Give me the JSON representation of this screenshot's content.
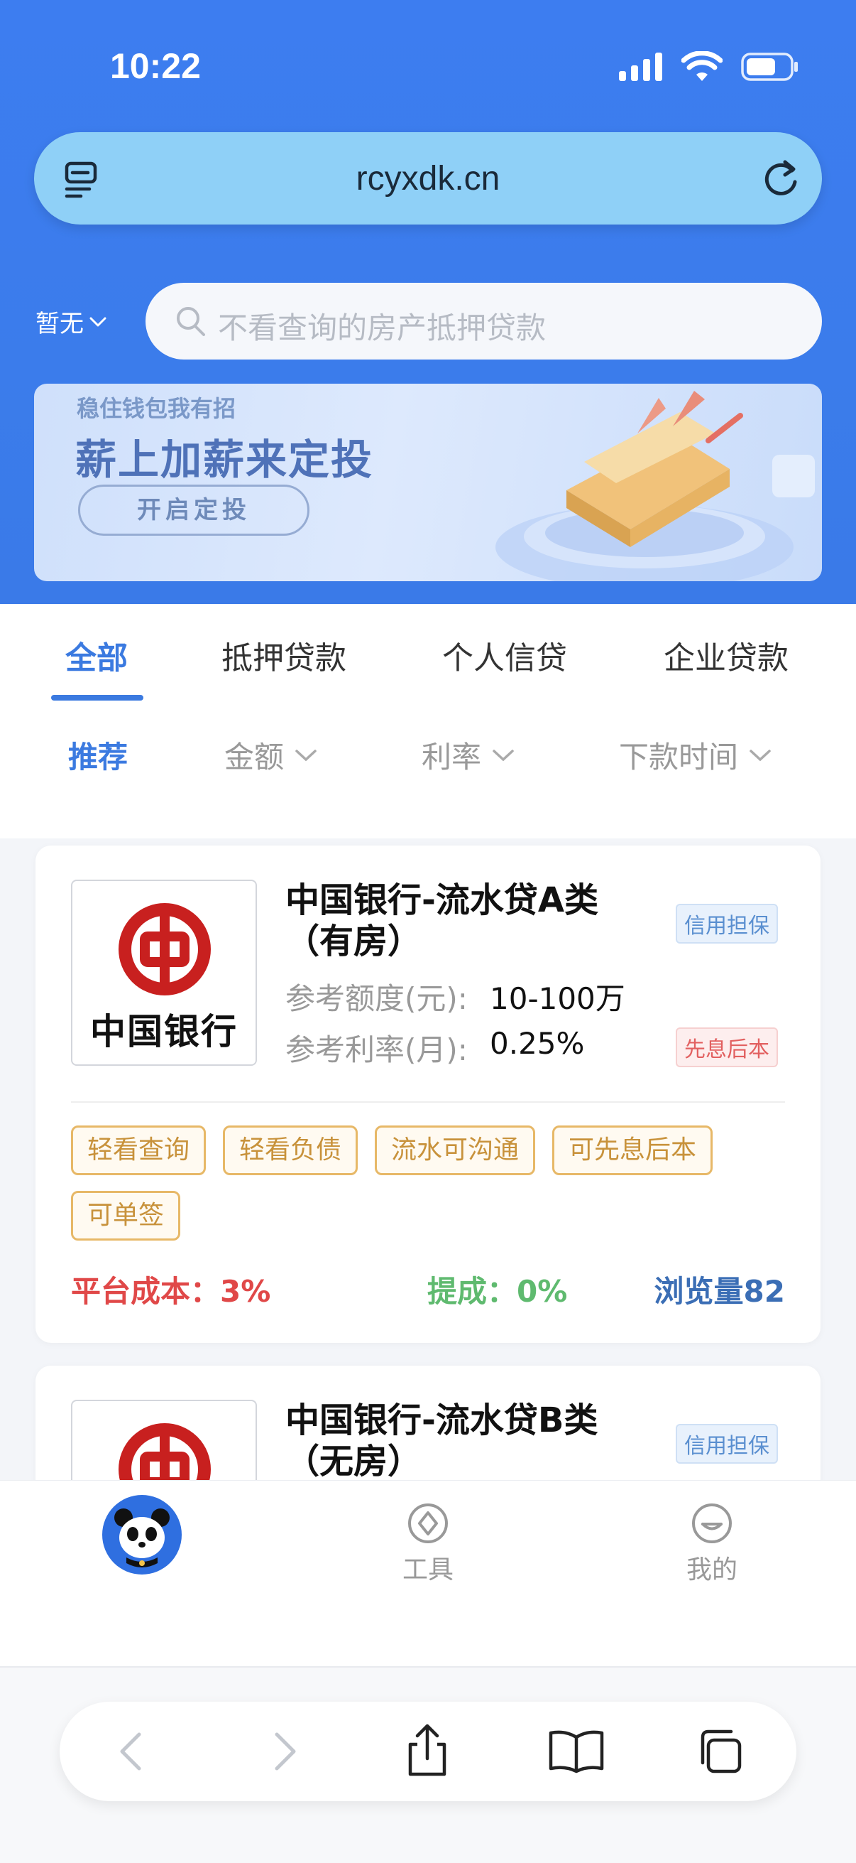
{
  "status": {
    "time": "10:22"
  },
  "browser": {
    "url": "rcyxdk.cn"
  },
  "location": {
    "city": "暂无"
  },
  "search": {
    "placeholder": "不看查询的房产抵押贷款"
  },
  "banner": {
    "small_text": "稳住钱包我有招",
    "headline": "薪上加薪来定投",
    "button_label": "开启定投"
  },
  "tabs": [
    "全部",
    "抵押贷款",
    "个人信贷",
    "企业贷款"
  ],
  "filters": [
    {
      "label": "推荐",
      "dropdown": false
    },
    {
      "label": "金额",
      "dropdown": true
    },
    {
      "label": "利率",
      "dropdown": true
    },
    {
      "label": "下款时间",
      "dropdown": true
    }
  ],
  "products": [
    {
      "logo_text": "中国银行",
      "title": "中国银行-流水贷A类（有房）",
      "tag_top": "信用担保",
      "tag_bottom": "先息后本",
      "amount_label": "参考额度(元):",
      "amount_value": "10-100万",
      "rate_label": "参考利率(月):",
      "rate_value": "0.25%",
      "features": [
        "轻看查询",
        "轻看负债",
        "流水可沟通",
        "可先息后本",
        "可单签"
      ],
      "cost": "平台成本：3%",
      "commission": "提成：0%",
      "views": "浏览量82"
    },
    {
      "title": "中国银行-流水贷B类（无房）",
      "tag_top": "信用担保"
    }
  ],
  "bottom_nav": [
    {
      "label": "",
      "icon": "panda-icon"
    },
    {
      "label": "工具",
      "icon": "compass-icon"
    },
    {
      "label": "我的",
      "icon": "smiley-icon"
    }
  ],
  "colors": {
    "primary_blue": "#3b7ae0",
    "header_blue": "#3d7df0",
    "cost_red": "#e04848",
    "commission_green": "#5fba6f",
    "tag_gold": "#c8923b"
  }
}
